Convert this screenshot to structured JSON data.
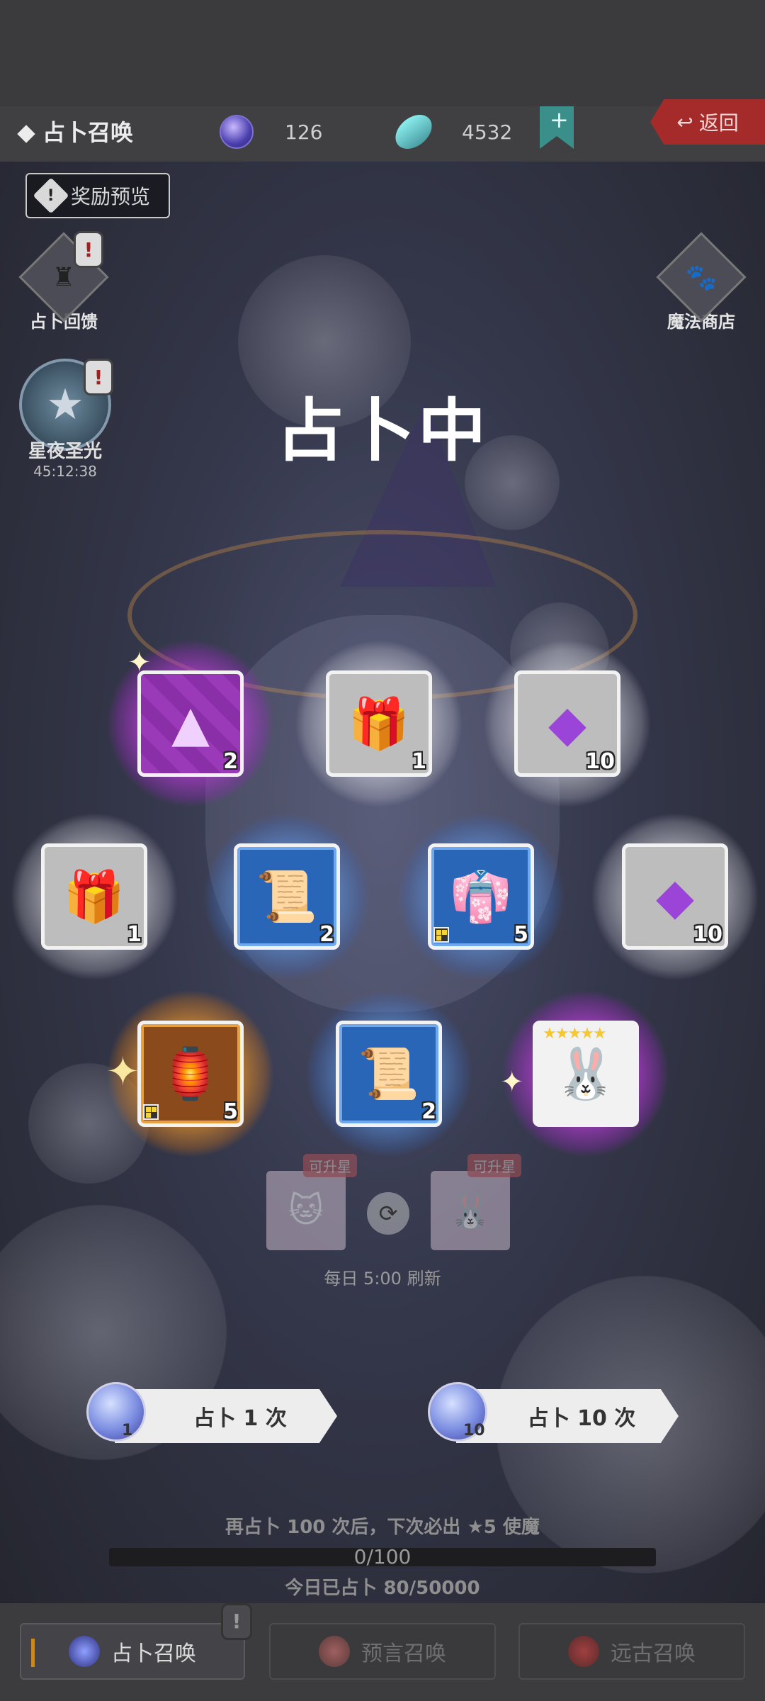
{
  "header": {
    "title": "占卜召唤",
    "orb_count": "126",
    "gem_count": "4532",
    "back_label": "返回"
  },
  "side": {
    "reward_preview": "奖励预览",
    "feedback": "占卜回馈",
    "magic_shop": "魔法商店",
    "starnight_label": "星夜圣光",
    "starnight_timer": "45:12:38",
    "badge": "!"
  },
  "status_text": "占卜中",
  "rewards": [
    {
      "icon": "purple-dust-icon",
      "count": "2",
      "rarity": "purple"
    },
    {
      "icon": "gift-box-icon",
      "count": "1",
      "rarity": "white"
    },
    {
      "icon": "purple-crystal-pile-icon",
      "count": "10",
      "rarity": "white"
    },
    {
      "icon": "gift-box-icon",
      "count": "1",
      "rarity": "white"
    },
    {
      "icon": "blue-scroll-icon",
      "count": "2",
      "rarity": "blue"
    },
    {
      "icon": "red-outfit-fragment-icon",
      "count": "5",
      "rarity": "blue"
    },
    {
      "icon": "purple-crystal-pile-icon",
      "count": "10",
      "rarity": "white"
    },
    {
      "icon": "lantern-fragment-icon",
      "count": "5",
      "rarity": "orange"
    },
    {
      "icon": "blue-scroll-icon",
      "count": "2",
      "rarity": "blue"
    },
    {
      "icon": "rabbit-envoy-icon",
      "count": "",
      "rarity": "purple",
      "stars": "★★★★★"
    }
  ],
  "preview": {
    "upgrade_tag": "可升星",
    "refresh_note": "每日 5:00 刷新"
  },
  "draw": {
    "single_label": "占卜 1 次",
    "single_cost": "1",
    "ten_label": "占卜 10 次",
    "ten_cost": "10"
  },
  "progress": {
    "hint": "再占卜 100 次后，下次必出 ★5 使魔",
    "value_text": "0/100",
    "fraction": 0,
    "daily": "今日已占卜 80/50000"
  },
  "tabs": {
    "t1": "占卜召唤",
    "t2": "预言召唤",
    "t3": "远古召唤"
  },
  "colors": {
    "accent": "#c88a20",
    "back_button": "#a52a2a"
  }
}
